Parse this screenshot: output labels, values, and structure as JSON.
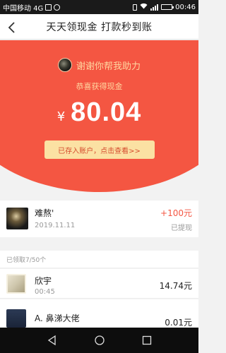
{
  "status_bar": {
    "carrier": "中国移动 4G",
    "time": "00:46"
  },
  "header": {
    "title": "天天领现金 打款秒到账"
  },
  "hero": {
    "thanks": "谢谢你帮我助力",
    "congrats": "恭喜获得现金",
    "currency_symbol": "¥",
    "amount": "80.04",
    "deposit_button": "已存入账户，点击查看>>"
  },
  "my_record": {
    "name": "难熬'",
    "date": "2019.11.11",
    "amount": "+100元",
    "status": "已提现"
  },
  "received": {
    "header": "已领取7/50个",
    "items": [
      {
        "name": "欣宇",
        "time": "00:45",
        "amount": "14.74元"
      },
      {
        "name": "A. 鼻涕大佬",
        "time": "",
        "amount": "0.01元"
      }
    ]
  },
  "colors": {
    "accent": "#f45642",
    "gold": "#ffd6a0",
    "button": "#fbe1a3"
  }
}
